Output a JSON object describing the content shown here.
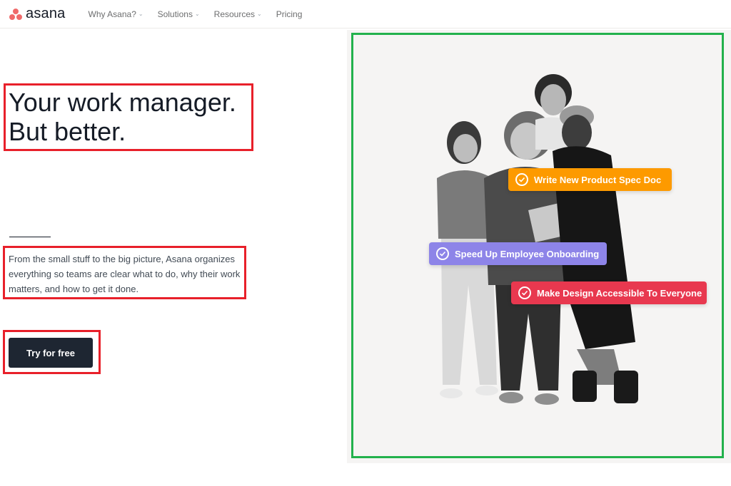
{
  "brand": {
    "name": "asana",
    "color": "#f06a6a"
  },
  "nav": {
    "items": [
      {
        "label": "Why Asana?",
        "dropdown": true
      },
      {
        "label": "Solutions",
        "dropdown": true
      },
      {
        "label": "Resources",
        "dropdown": true
      },
      {
        "label": "Pricing",
        "dropdown": false
      }
    ]
  },
  "hero": {
    "headline_line1": "Your work manager.",
    "headline_line2": "But better.",
    "description": "From the small stuff to the big picture, Asana organizes everything so teams are clear what to do, why their work matters, and how to get it done.",
    "cta_label": "Try for free"
  },
  "image_panel": {
    "tasks": [
      {
        "label": "Write New Product Spec Doc",
        "color": "#fd9a00"
      },
      {
        "label": "Speed Up Employee Onboarding",
        "color": "#8d84e8"
      },
      {
        "label": "Make Design Accessible To Everyone",
        "color": "#e8384f"
      }
    ],
    "icons": {
      "check": "check-circle-icon",
      "chevron": "chevron-down-icon"
    }
  },
  "annotation_colors": {
    "highlight": "#e8202a",
    "image_frame": "#22b14c"
  }
}
